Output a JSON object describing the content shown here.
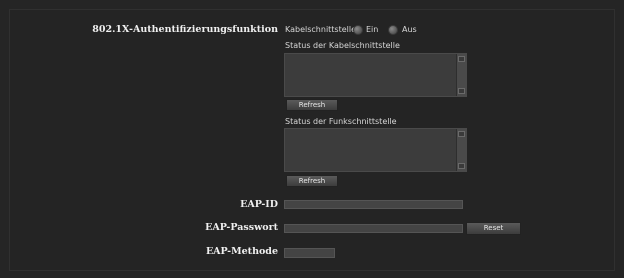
{
  "auth": {
    "label": "802.1X-Authentifizierungsfunktion",
    "interface_label": "Kabelschnittstelle",
    "on_label": "Ein",
    "off_label": "Aus"
  },
  "wired_status": {
    "label": "Status der Kabelschnittstelle",
    "refresh_label": "Refresh"
  },
  "wireless_status": {
    "label": "Status der Funkschnittstelle",
    "refresh_label": "Refresh"
  },
  "eap_id": {
    "label": "EAP-ID",
    "value": ""
  },
  "eap_password": {
    "label": "EAP-Passwort",
    "value": "",
    "reset_label": "Reset"
  },
  "eap_method": {
    "label": "EAP-Methode",
    "value": ""
  }
}
